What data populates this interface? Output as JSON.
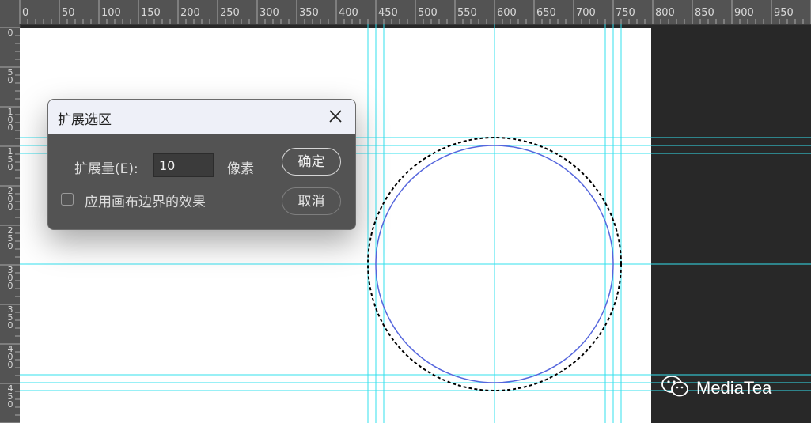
{
  "ruler": {
    "top_labels": [
      "0",
      "50",
      "100",
      "150",
      "200",
      "250",
      "300",
      "350",
      "400",
      "450",
      "500",
      "550",
      "600",
      "650",
      "700",
      "750",
      "800",
      "850",
      "900",
      "950"
    ],
    "left_labels": [
      "0",
      "50",
      "100",
      "150",
      "200",
      "250",
      "300",
      "350",
      "400",
      "450"
    ]
  },
  "dialog": {
    "title": "扩展选区",
    "expand_label": "扩展量(E):",
    "expand_value": "10",
    "unit": "像素",
    "apply_canvas_bounds_label": "应用画布边界的效果",
    "apply_canvas_bounds_checked": false,
    "ok_label": "确定",
    "cancel_label": "取消"
  },
  "watermark": {
    "text": "MediaTea",
    "icon": "wechat-icon"
  },
  "colors": {
    "guide": "#33e0ee",
    "circle": "#5566dd",
    "selection": "#000000",
    "dialog_bg": "#535353",
    "titlebar_bg": "#eef0f8"
  }
}
